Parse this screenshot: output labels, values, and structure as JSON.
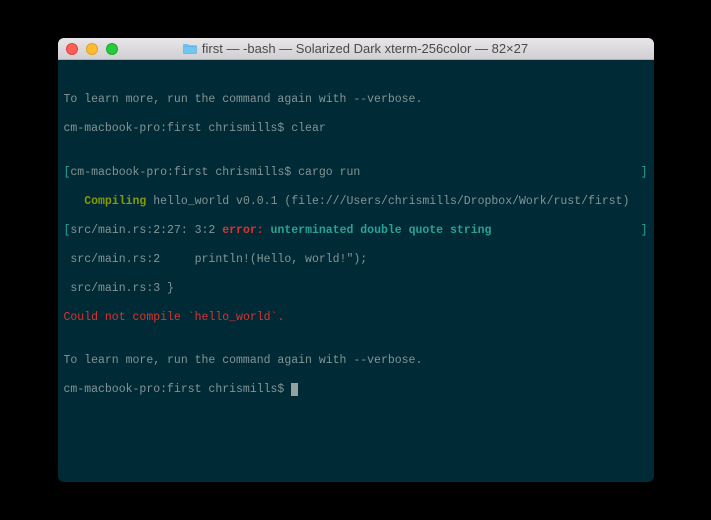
{
  "window": {
    "title": "first — -bash — Solarized Dark xterm-256color — 82×27"
  },
  "colors": {
    "bg": "#002b36",
    "base": "#839496",
    "green": "#859900",
    "red": "#dc322f",
    "cyan": "#2aa198"
  },
  "terminal": {
    "blank": "",
    "line1": "To learn more, run the command again with --verbose.",
    "line2_prompt": "cm-macbook-pro:first chrismills$ ",
    "line2_cmd": "clear",
    "line3_prompt_open": "[",
    "line3_prompt": "cm-macbook-pro:first chrismills$ ",
    "line3_cmd": "cargo run",
    "line3_close": "]",
    "line4_indent": "   ",
    "line4_compiling": "Compiling",
    "line4_rest": " hello_world v0.0.1 (file:///Users/chrismills/Dropbox/Work/rust/first)",
    "line5_open": "[",
    "line5_loc": "src/main.rs:2:27: 3:2 ",
    "line5_error": "error:",
    "line5_msg": " unterminated double quote string",
    "line5_close": "]",
    "line6": " src/main.rs:2     println!(Hello, world!\");",
    "line7": " src/main.rs:3 }",
    "line8_a": "Could not compile ",
    "line8_b": "`hello_world`",
    "line8_c": ".",
    "line9": "To learn more, run the command again with --verbose.",
    "line10_prompt": "cm-macbook-pro:first chrismills$ "
  }
}
